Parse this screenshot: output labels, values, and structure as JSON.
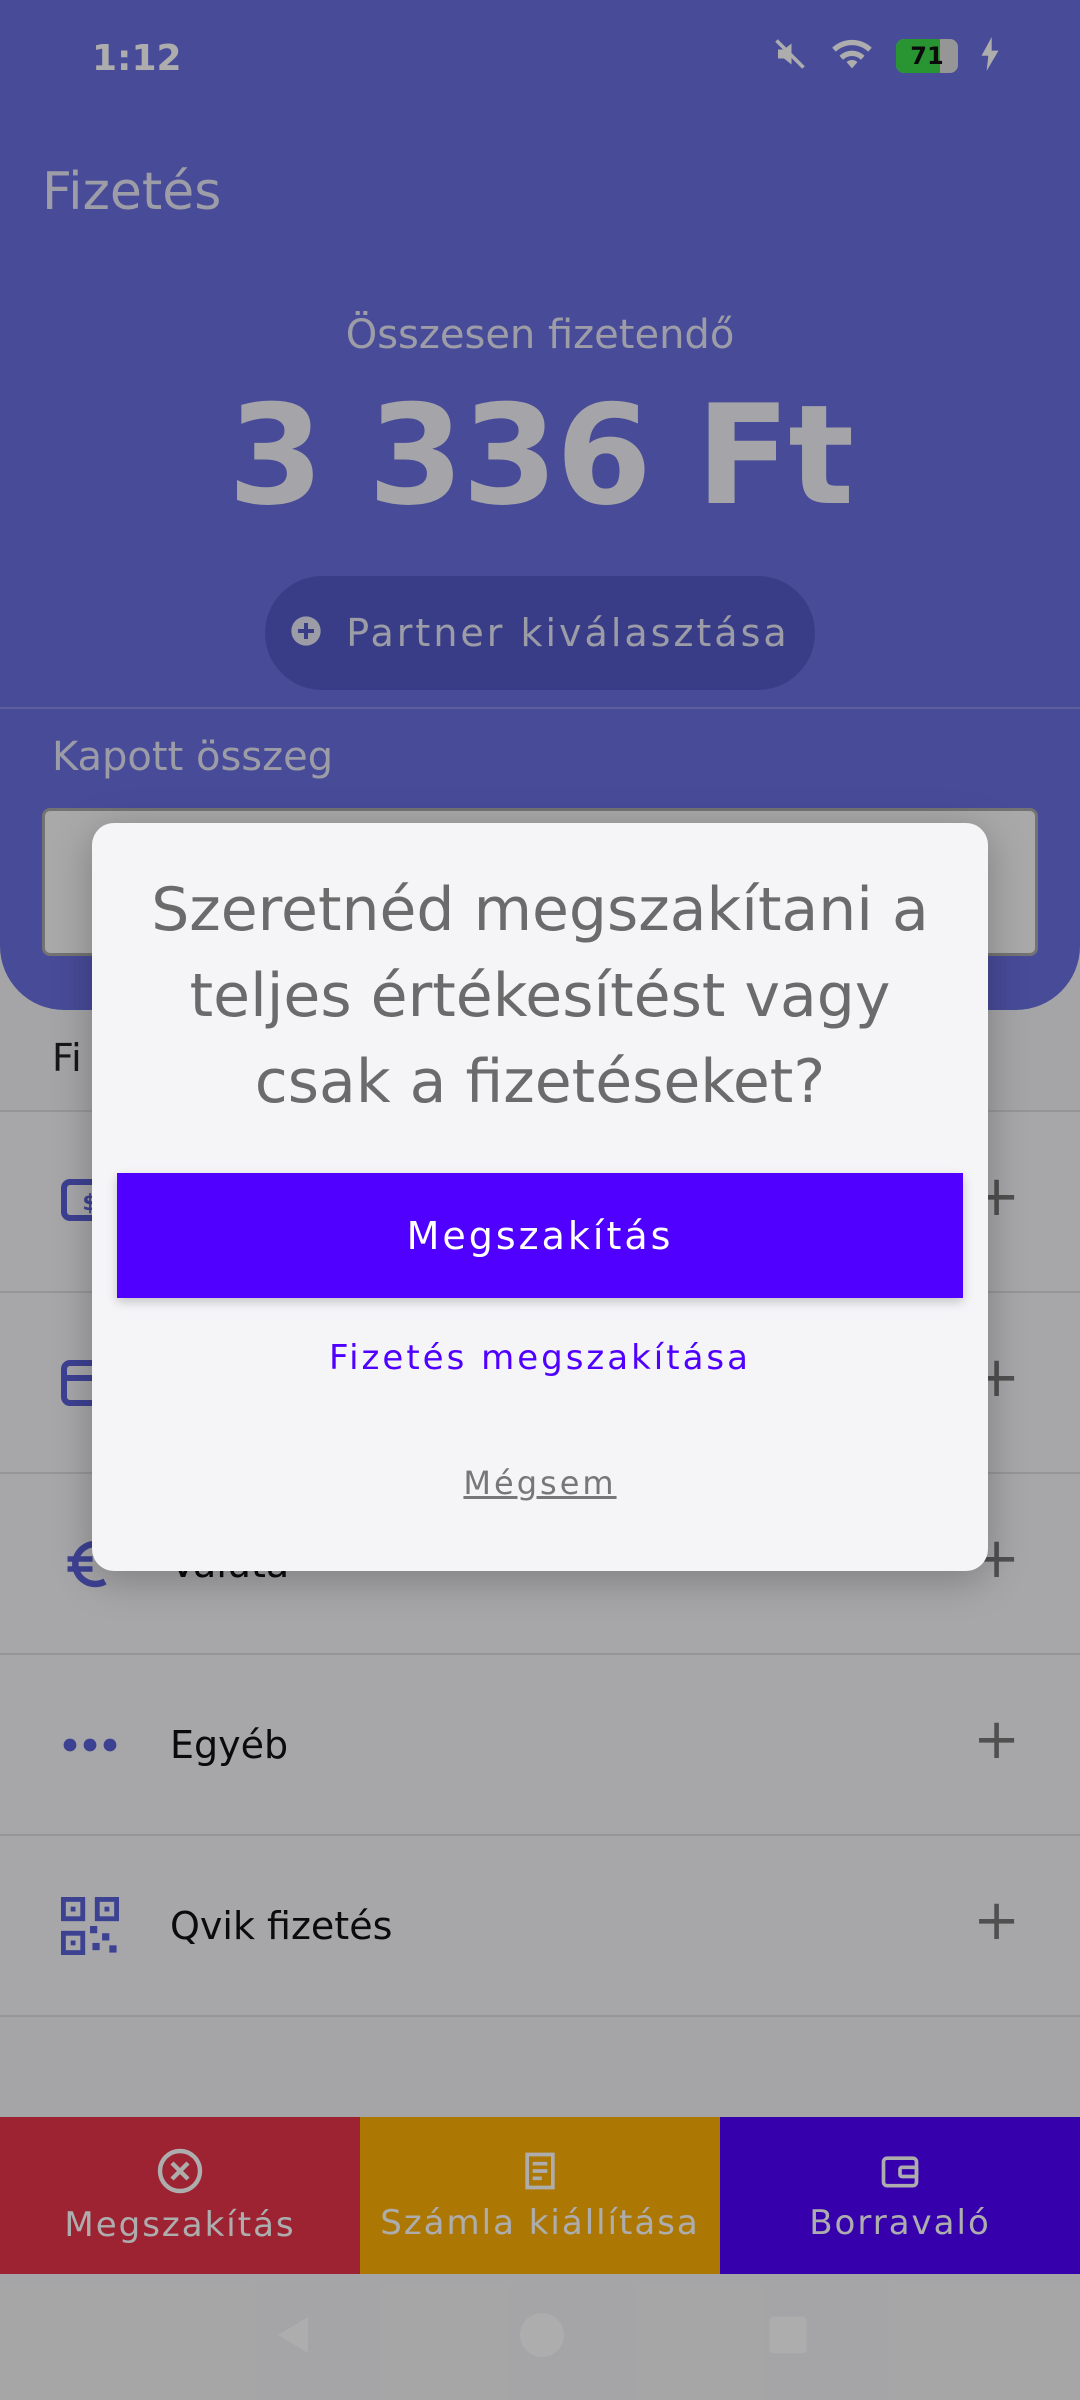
{
  "status_bar": {
    "time": "1:12",
    "battery_level": "71",
    "battery_fraction": 0.71
  },
  "header": {
    "title": "Fizetés",
    "total_label": "Összesen fizetendő",
    "total_amount": "3 336 Ft",
    "partner_button": "Partner kiválasztása",
    "received_label": "Kapott összeg"
  },
  "payments": {
    "section_label": "Fi",
    "items": [
      {
        "label": "",
        "icon": "cash-icon"
      },
      {
        "label": "",
        "icon": "card-icon"
      },
      {
        "label": "Valuta",
        "icon": "euro-icon"
      },
      {
        "label": "Egyéb",
        "icon": "more-dots-icon"
      },
      {
        "label": "Qvik fizetés",
        "icon": "qr-code-icon"
      }
    ],
    "add_symbol": "+"
  },
  "bottom_bar": {
    "cancel_label": "Megszakítás",
    "invoice_label": "Számla kiállítása",
    "tip_label": "Borravaló"
  },
  "dialog": {
    "title": "Szeretnéd megszakítani a teljes értékesítést vagy csak a fizetéseket?",
    "primary_label": "Megszakítás",
    "secondary_label": "Fizetés megszakítása",
    "tertiary_label": "Mégsem"
  },
  "colors": {
    "header": "#6a6fe0",
    "primary": "#5000ff",
    "cancel": "#e8344c",
    "invoice": "#ffb006"
  }
}
